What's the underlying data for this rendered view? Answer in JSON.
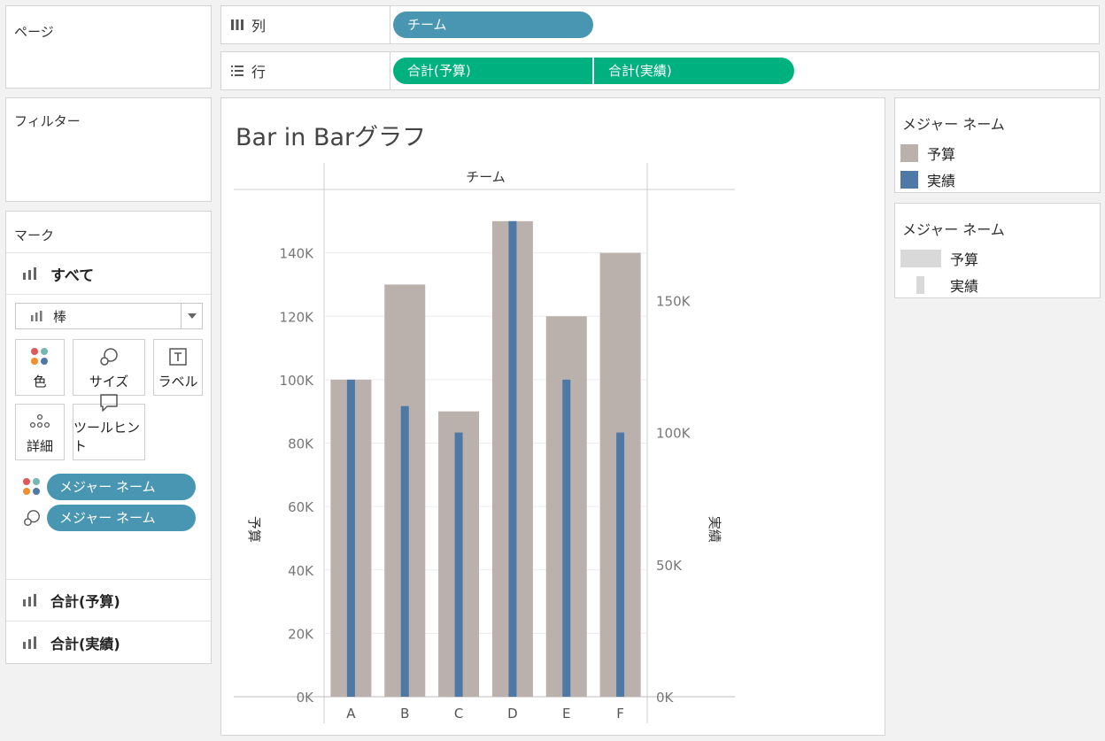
{
  "pages_shelf": {
    "title": "ページ"
  },
  "filters_shelf": {
    "title": "フィルター"
  },
  "columns_shelf": {
    "label": "列",
    "pills": [
      "チーム"
    ]
  },
  "rows_shelf": {
    "label": "行",
    "pills": [
      "合計(予算)",
      "合計(実績)"
    ]
  },
  "marks_card": {
    "title": "マーク",
    "all_label": "すべて",
    "mark_type": "棒",
    "buttons": {
      "color": "色",
      "size": "サイズ",
      "label": "ラベル",
      "detail": "詳細",
      "tooltip": "ツールヒント"
    },
    "fields": [
      "メジャー ネーム",
      "メジャー ネーム"
    ],
    "measures": [
      "合計(予算)",
      "合計(実績)"
    ]
  },
  "color_legend": {
    "title": "メジャー ネーム",
    "items": [
      {
        "label": "予算",
        "color": "#bab0ac"
      },
      {
        "label": "実績",
        "color": "#4e79a7"
      }
    ]
  },
  "size_legend": {
    "title": "メジャー ネーム",
    "items": [
      {
        "label": "予算"
      },
      {
        "label": "実績"
      }
    ]
  },
  "chart_data": {
    "type": "bar",
    "title": "Bar in Barグラフ",
    "header": "チーム",
    "categories": [
      "A",
      "B",
      "C",
      "D",
      "E",
      "F"
    ],
    "series": [
      {
        "name": "予算",
        "axis": "left",
        "color": "#bab0ac",
        "values": [
          100000,
          130000,
          90000,
          150000,
          120000,
          140000
        ]
      },
      {
        "name": "実績",
        "axis": "right",
        "color": "#4e79a7",
        "values": [
          120000,
          110000,
          100000,
          180000,
          120000,
          100000
        ]
      }
    ],
    "left_axis": {
      "label": "予算",
      "min": 0,
      "max": 160000,
      "ticks": [
        0,
        20000,
        40000,
        60000,
        80000,
        100000,
        120000,
        140000
      ],
      "tick_labels": [
        "0K",
        "20K",
        "40K",
        "60K",
        "80K",
        "100K",
        "120K",
        "140K"
      ]
    },
    "right_axis": {
      "label": "実績",
      "min": 0,
      "max": 192000,
      "ticks": [
        0,
        50000,
        100000,
        150000
      ],
      "tick_labels": [
        "0K",
        "50K",
        "100K",
        "150K"
      ]
    },
    "grid": true
  }
}
